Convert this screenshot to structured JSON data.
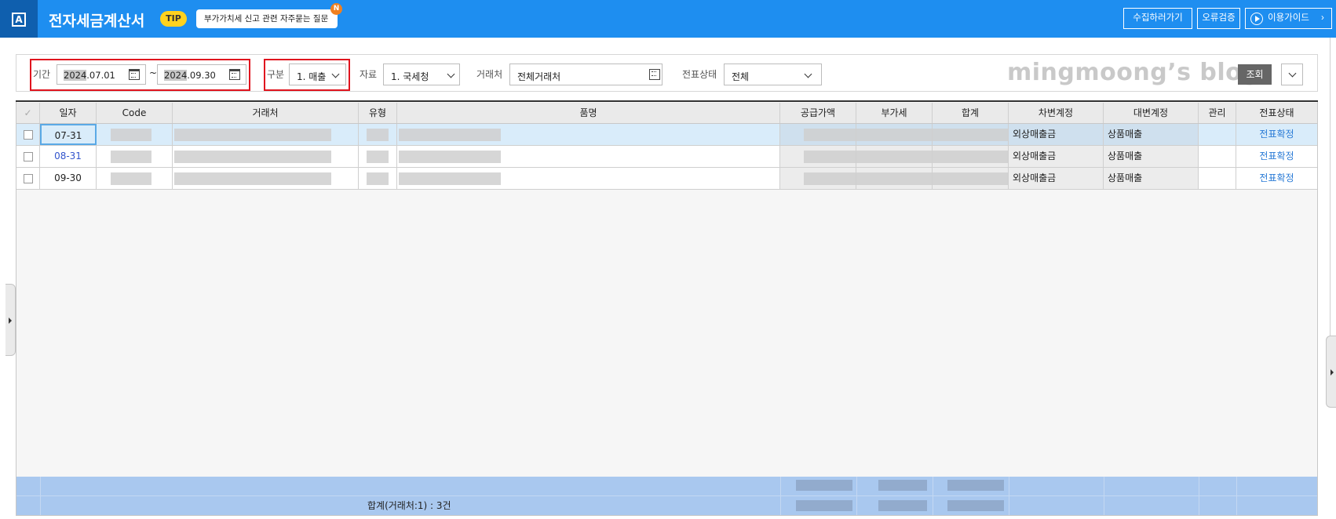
{
  "header": {
    "logo_letter": "A",
    "title": "전자세금계산서",
    "tip_label": "TIP",
    "tip_text": "부가가치세 신고 관련 자주묻는 질문",
    "new_badge": "N",
    "collect_button": "수집하러가기",
    "error_check_button": "오류검증",
    "guide_button": "이용가이드",
    "guide_chevron": "›"
  },
  "filters": {
    "period_label": "기간",
    "start_year": "2024",
    "start_rest": ".07.01",
    "tilde": "~",
    "end_year": "2024",
    "end_rest": ".09.30",
    "gubun_label": "구분",
    "gubun_value": "1. 매출",
    "source_label": "자료",
    "source_value": "1. 국세청",
    "partner_label": "거래처",
    "partner_value": "전체거래처",
    "status_label": "전표상태",
    "status_value": "전체",
    "search_button": "조회"
  },
  "watermark": "mingmoong’s blog",
  "table": {
    "check_header": "✓",
    "columns": [
      "일자",
      "Code",
      "거래처",
      "유형",
      "품명",
      "공급가액",
      "부가세",
      "합계",
      "차변계정",
      "대변계정",
      "관리",
      "전표상태"
    ],
    "rows": [
      {
        "date": "07-31",
        "debit": "외상매출금",
        "credit": "상품매출",
        "status": "전표확정"
      },
      {
        "date": "08-31",
        "debit": "외상매출금",
        "credit": "상품매출",
        "status": "전표확정"
      },
      {
        "date": "09-30",
        "debit": "외상매출금",
        "credit": "상품매출",
        "status": "전표확정"
      }
    ],
    "footer_total": "합계(거래처:1) : 3건"
  },
  "colors": {
    "topbar": "#1e8ef0",
    "accent_red": "#e0141e",
    "selected_row": "#d9ecfa",
    "footer": "#a9c8ef",
    "link": "#2a7bd6"
  }
}
